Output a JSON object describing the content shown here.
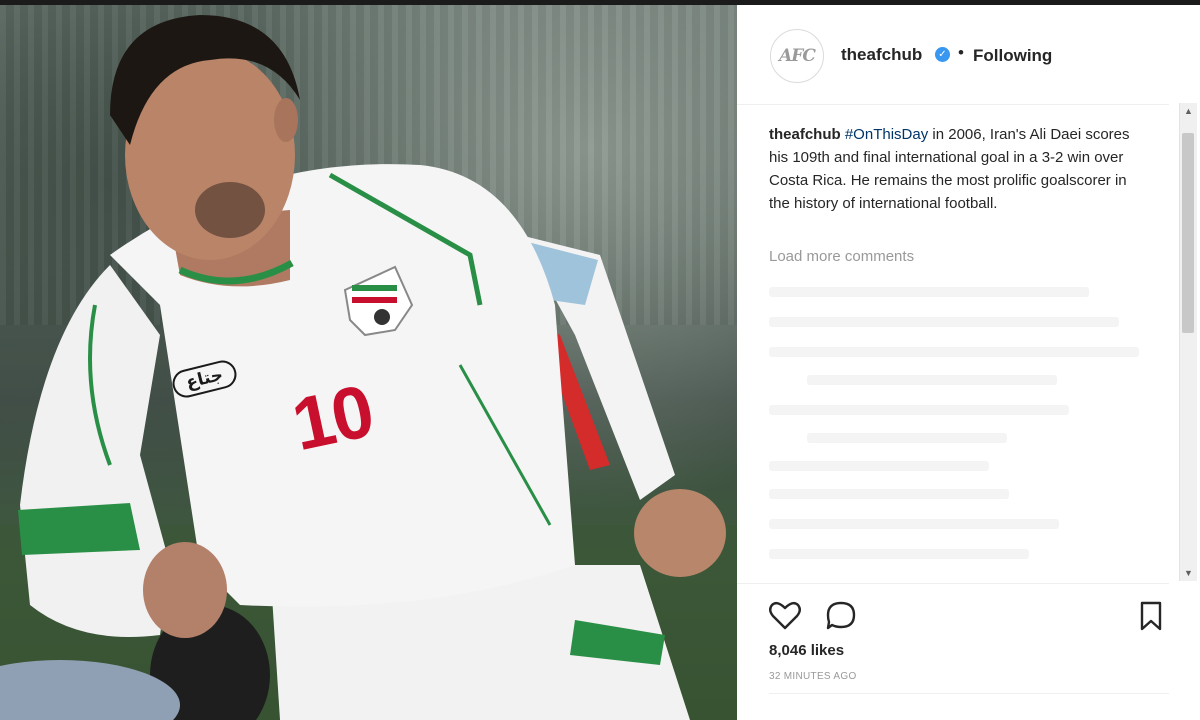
{
  "post": {
    "photo_alt": "",
    "jersey_number": "10",
    "sponsor_text": "جتاع"
  },
  "account": {
    "avatar_text": "AFC",
    "handle": "theafchub",
    "verified_mark": "✓",
    "separator": "•",
    "follow_state": "Following"
  },
  "caption": {
    "username": "theafchub",
    "hashtag": "#OnThisDay",
    "text": " in 2006, Iran's Ali Daei scores his 109th and final international goal in a 3-2 win over Costa Rica. He remains the most prolific goalscorer in the history of international football."
  },
  "comments": {
    "load_more": "Load more comments"
  },
  "actions": {
    "like_icon": "heart-icon",
    "comment_icon": "comment-icon",
    "save_icon": "bookmark-icon"
  },
  "stats": {
    "likes": "8,046 likes",
    "time": "32 MINUTES AGO"
  },
  "scrollbar": {
    "up": "▲",
    "down": "▼"
  },
  "colors": {
    "link": "#003569",
    "verified": "#3897f0",
    "muted": "#999999",
    "jersey_number": "#c8102e",
    "jersey_trim": "#239f40"
  }
}
